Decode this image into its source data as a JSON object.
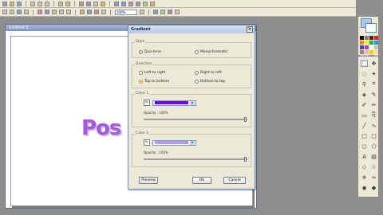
{
  "image_window": {
    "title": "Untitled 5"
  },
  "toolbar": {
    "zoom_value": "100%"
  },
  "canvas": {
    "text": "Pos"
  },
  "dialog": {
    "title": "Gradient",
    "style_group": {
      "label": "Style",
      "options": [
        "Duo-tone",
        "Monochromatic"
      ],
      "selected": "Duo-tone"
    },
    "direction_group": {
      "label": "Direction",
      "options": [
        "Left to right",
        "Right to left",
        "Top to bottom",
        "Bottom to top"
      ],
      "selected": "Top to bottom"
    },
    "color1_group": {
      "label": "Color 1",
      "color": "#6e0fc4",
      "opacity_label": "Opacity : 100%",
      "opacity_value": 100
    },
    "color2_group": {
      "label": "Color 2",
      "color": "#b79be3",
      "opacity_label": "Opacity : 100%",
      "opacity_value": 100
    },
    "buttons": {
      "preview": "Preview",
      "ok": "Ok",
      "cancel": "Cancel"
    }
  },
  "palette": {
    "primary_color": "#a8c8f0",
    "secondary_color": "#ffffff",
    "swatches": [
      "#000000",
      "#7f7f7f",
      "#880015",
      "#ed1c24",
      "#ff7f27",
      "#fff200",
      "#22b14c",
      "#00a2e8",
      "#3f48cc",
      "#a349a4",
      "#ffffff",
      "#c3c3c3",
      "#b97a57",
      "#ffaec9",
      "#ffc90e",
      "#efe4b0",
      "#b5e61d",
      "#99d9ea",
      "#7092be",
      "#c8bfe7"
    ]
  },
  "tools": [
    "select-icon",
    "move-icon",
    "lasso-icon",
    "magic-wand-icon",
    "zoom-icon",
    "crop-icon",
    "fill-icon",
    "picker-icon",
    "brush-icon",
    "pencil-icon",
    "eraser-icon",
    "clone-icon",
    "line-icon",
    "curve-icon",
    "rect-icon",
    "round-rect-icon",
    "ellipse-icon",
    "polygon-icon",
    "text-icon",
    "gradient-icon",
    "shape-icon",
    "star-icon",
    "airbrush-icon",
    "smudge-icon",
    "red-eye-icon",
    "sharpen-icon"
  ]
}
